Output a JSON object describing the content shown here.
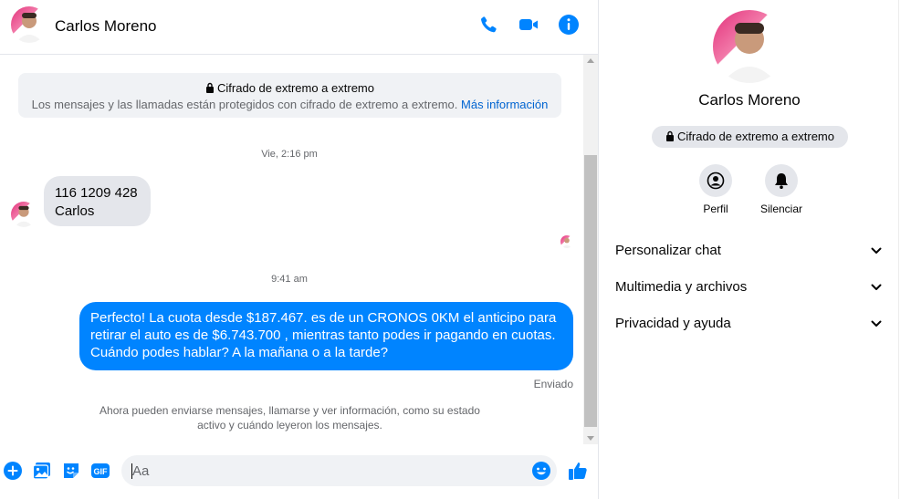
{
  "header": {
    "contact_name": "Carlos Moreno",
    "icons": [
      "phone-icon",
      "video-camera-icon",
      "info-icon"
    ]
  },
  "encryption_notice": {
    "title": "Cifrado de extremo a extremo",
    "description": "Los mensajes y las llamadas están protegidos con cifrado de extremo a extremo.",
    "link": "Más información"
  },
  "conversation": {
    "timestamp_1": "Vie, 2:16 pm",
    "incoming_message": {
      "line1": "116 1209 428",
      "line2": "Carlos"
    },
    "timestamp_2": "9:41 am",
    "outgoing_message": {
      "line1": "Perfecto! La cuota desde $187.467. es de un CRONOS 0KM el anticipo para",
      "line2": "retirar el auto es de $6.743.700 , mientras tanto podes ir pagando en cuotas.",
      "line3": "Cuándo podes hablar? A la mañana o a la tarde?"
    },
    "status": "Enviado",
    "system_note": {
      "line1": "Ahora pueden enviarse mensajes, llamarse y ver información, como su estado",
      "line2": "activo y cuándo leyeron los mensajes."
    }
  },
  "composer": {
    "placeholder": "Aa",
    "gif_label": "GIF"
  },
  "info_panel": {
    "name": "Carlos Moreno",
    "encryption_pill": "Cifrado de extremo a extremo",
    "actions": {
      "profile": "Perfil",
      "mute": "Silenciar"
    },
    "sections": {
      "customize": "Personalizar chat",
      "media": "Multimedia y archivos",
      "privacy": "Privacidad y ayuda"
    }
  },
  "colors": {
    "accent": "#0084ff",
    "icon_blue": "#0084ff",
    "incoming_bubble": "#e4e6eb",
    "secondary_text": "#65676b",
    "link": "#0064d1"
  }
}
